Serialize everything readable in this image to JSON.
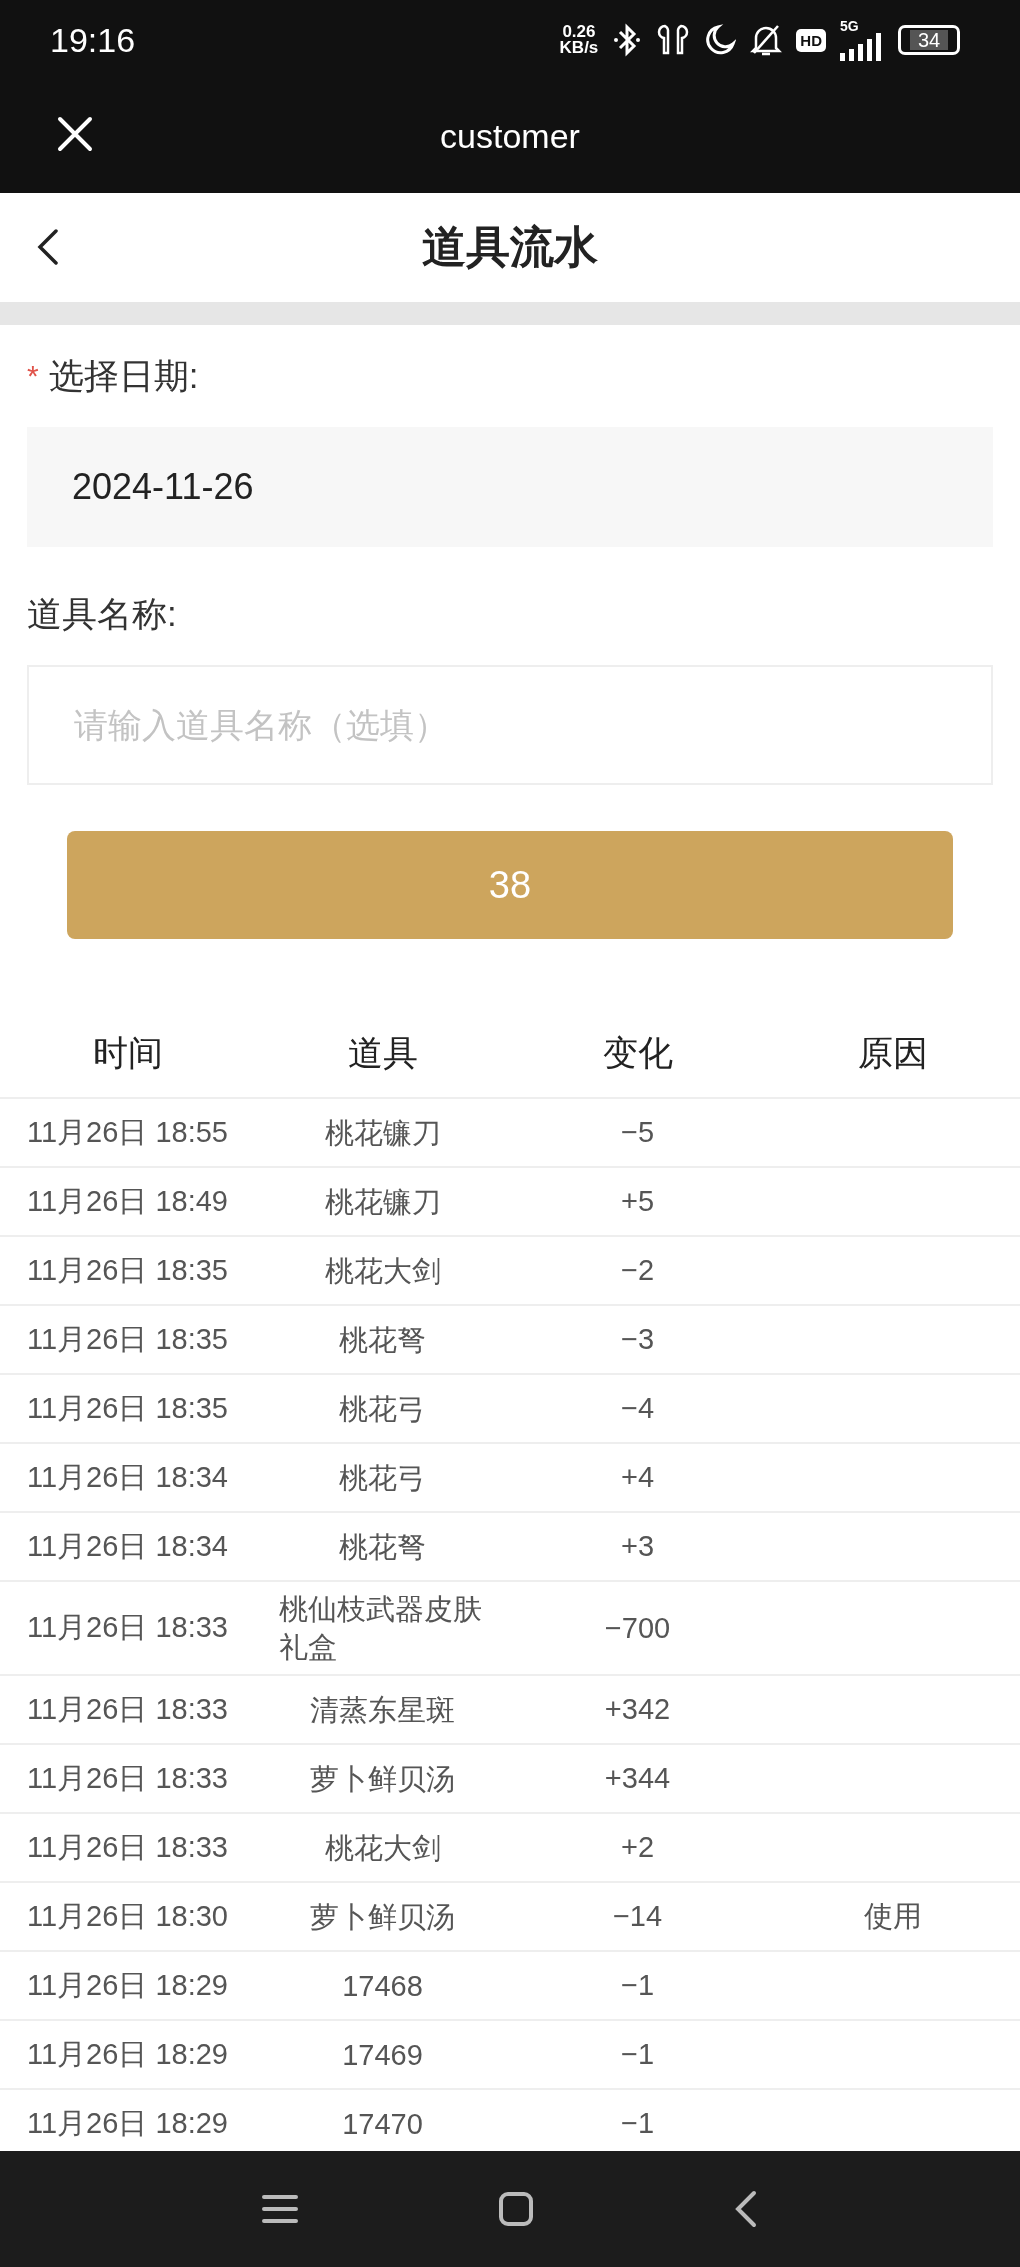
{
  "status_bar": {
    "time": "19:16",
    "net_speed_value": "0.26",
    "net_speed_unit": "KB/s",
    "hd_label": "HD",
    "network_label": "5G",
    "battery": "34"
  },
  "app_bar": {
    "title": "customer"
  },
  "header": {
    "title": "道具流水"
  },
  "form": {
    "date_label": "选择日期:",
    "required_mark": "*",
    "date_value": "2024-11-26",
    "name_label": "道具名称:",
    "name_placeholder": "请输入道具名称（选填）",
    "submit_label": "38"
  },
  "table": {
    "columns": [
      "时间",
      "道具",
      "变化",
      "原因"
    ],
    "rows": [
      {
        "time": "11月26日 18:55",
        "item": "桃花镰刀",
        "change": "−5"
      },
      {
        "time": "11月26日 18:49",
        "item": "桃花镰刀",
        "change": "+5"
      },
      {
        "time": "11月26日 18:35",
        "item": "桃花大剑",
        "change": "−2"
      },
      {
        "time": "11月26日 18:35",
        "item": "桃花弩",
        "change": "−3"
      },
      {
        "time": "11月26日 18:35",
        "item": "桃花弓",
        "change": "−4"
      },
      {
        "time": "11月26日 18:34",
        "item": "桃花弓",
        "change": "+4"
      },
      {
        "time": "11月26日 18:34",
        "item": "桃花弩",
        "change": "+3"
      },
      {
        "time": "11月26日 18:33",
        "item": "桃仙枝武器皮肤礼盒",
        "change": "−700"
      },
      {
        "time": "11月26日 18:33",
        "item": "清蒸东星斑",
        "change": "+342"
      },
      {
        "time": "11月26日 18:33",
        "item": "萝卜鲜贝汤",
        "change": "+344"
      },
      {
        "time": "11月26日 18:33",
        "item": "桃花大剑",
        "change": "+2"
      },
      {
        "time": "11月26日 18:30",
        "item": "萝卜鲜贝汤",
        "change": "−14",
        "reason": "使用"
      },
      {
        "time": "11月26日 18:29",
        "item": "17468",
        "change": "−1"
      },
      {
        "time": "11月26日 18:29",
        "item": "17469",
        "change": "−1"
      },
      {
        "time": "11月26日 18:29",
        "item": "17470",
        "change": "−1"
      }
    ]
  }
}
